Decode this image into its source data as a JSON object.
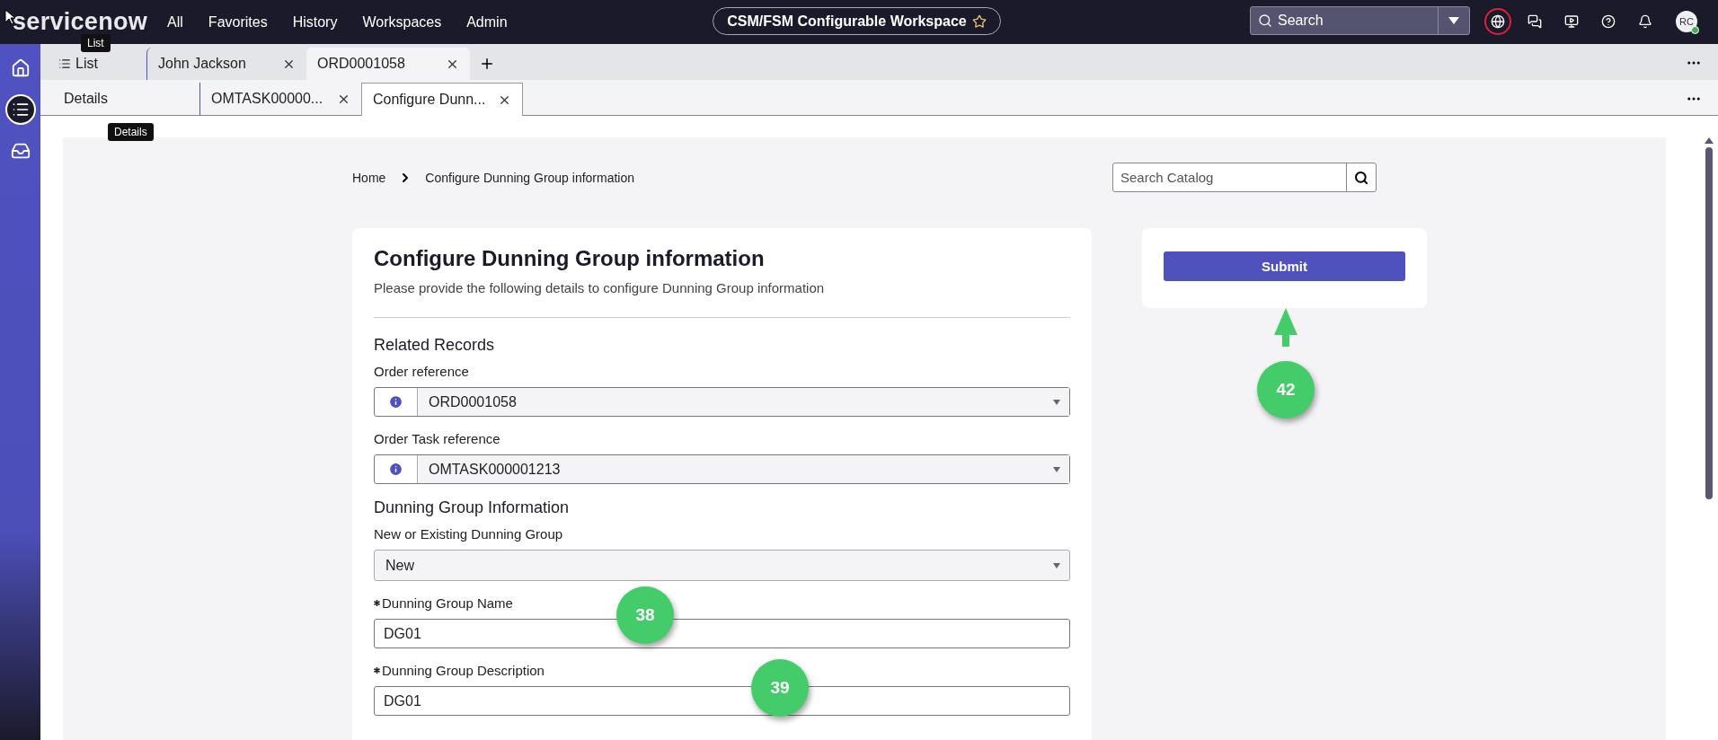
{
  "top_bar": {
    "logo": "servicenow",
    "menu": [
      {
        "label": "All"
      },
      {
        "label": "Favorites"
      },
      {
        "label": "History"
      },
      {
        "label": "Workspaces"
      },
      {
        "label": "Admin"
      }
    ],
    "workspace": "CSM/FSM Configurable Workspace",
    "search": {
      "placeholder": "Search"
    },
    "avatar": "RC"
  },
  "primary_tabs": [
    {
      "label": "List",
      "kind": "list",
      "selected": false,
      "closable": false
    },
    {
      "label": "John Jackson",
      "kind": "record",
      "selected": false,
      "closable": true
    },
    {
      "label": "ORD0001058",
      "kind": "record",
      "selected": true,
      "closable": true
    }
  ],
  "secondary_tabs": [
    {
      "label": "Details",
      "selected": false,
      "closable": false
    },
    {
      "label": "OMTASK00000...",
      "selected": false,
      "closable": true
    },
    {
      "label": "Configure Dunn...",
      "selected": true,
      "closable": true
    }
  ],
  "tooltips": [
    {
      "text": "List"
    },
    {
      "text": "Details"
    }
  ],
  "breadcrumb": [
    "Home",
    "Configure Dunning Group information"
  ],
  "search_catalog": {
    "placeholder": "Search Catalog"
  },
  "form": {
    "title": "Configure Dunning Group information",
    "subtitle": "Please provide the following details to configure Dunning Group information",
    "sections": [
      {
        "heading": "Related Records",
        "fields": [
          {
            "label": "Order reference",
            "kind": "reference",
            "value": "ORD0001058",
            "required": false
          },
          {
            "label": "Order Task reference",
            "kind": "reference",
            "value": "OMTASK000001213",
            "required": false
          }
        ]
      },
      {
        "heading": "Dunning Group Information",
        "fields": [
          {
            "label": "New or Existing Dunning Group",
            "kind": "choice",
            "value": "New",
            "required": false
          },
          {
            "label": "Dunning Group Name",
            "kind": "text",
            "value": "DG01",
            "required": true,
            "annotation": "38"
          },
          {
            "label": "Dunning Group Description",
            "kind": "text",
            "value": "DG01",
            "required": true,
            "annotation": "39"
          }
        ]
      }
    ]
  },
  "submit": {
    "label": "Submit",
    "annotation": "42"
  }
}
